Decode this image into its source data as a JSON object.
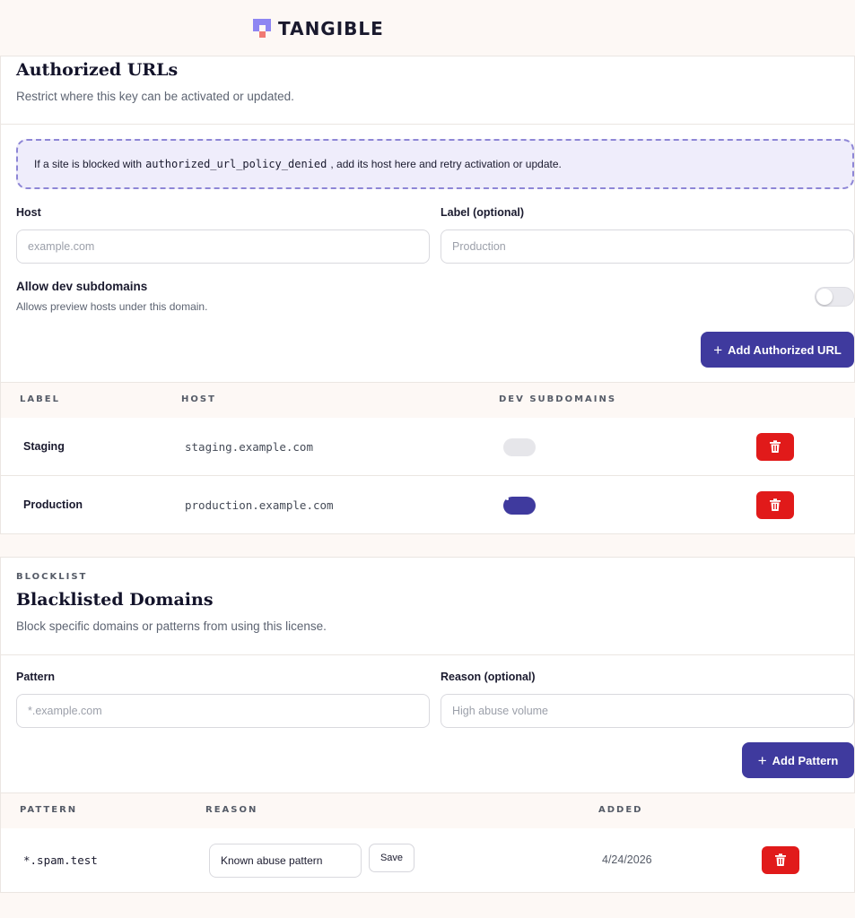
{
  "brand": {
    "name": "TANGIBLE"
  },
  "authorized": {
    "title": "Authorized URLs",
    "subtitle": "Restrict where this key can be activated or updated.",
    "notice": {
      "prefix": "If a site is blocked with",
      "code": "authorized_url_policy_denied",
      "suffix": ", add its host here and retry activation or update."
    },
    "host_label": "Host",
    "host_placeholder": "example.com",
    "label_label": "Label (optional)",
    "label_placeholder": "Production",
    "dev_title": "Allow dev subdomains",
    "dev_desc": "Allows preview hosts under this domain.",
    "dev_toggle_on": false,
    "add_button": "Add Authorized URL",
    "columns": [
      "LABEL",
      "HOST",
      "DEV SUBDOMAINS"
    ],
    "rows": [
      {
        "label": "Staging",
        "host": "staging.example.com",
        "dev": false
      },
      {
        "label": "Production",
        "host": "production.example.com",
        "dev": true
      }
    ]
  },
  "blocklist": {
    "eyebrow": "BLOCKLIST",
    "title": "Blacklisted Domains",
    "subtitle": "Block specific domains or patterns from using this license.",
    "pattern_label": "Pattern",
    "pattern_placeholder": "*.example.com",
    "reason_label": "Reason (optional)",
    "reason_placeholder": "High abuse volume",
    "add_button": "Add Pattern",
    "columns": [
      "PATTERN",
      "REASON",
      "ADDED"
    ],
    "rows": [
      {
        "pattern": "*.spam.test",
        "reason": "Known abuse pattern",
        "save_label": "Save",
        "added": "4/24/2026"
      }
    ]
  },
  "colors": {
    "primary": "#3f3a9e",
    "danger": "#e11a1a",
    "background": "#fdf8f5",
    "notice_bg": "#efedfb"
  },
  "icons": {
    "add": "plus-icon",
    "delete": "trash-icon"
  }
}
